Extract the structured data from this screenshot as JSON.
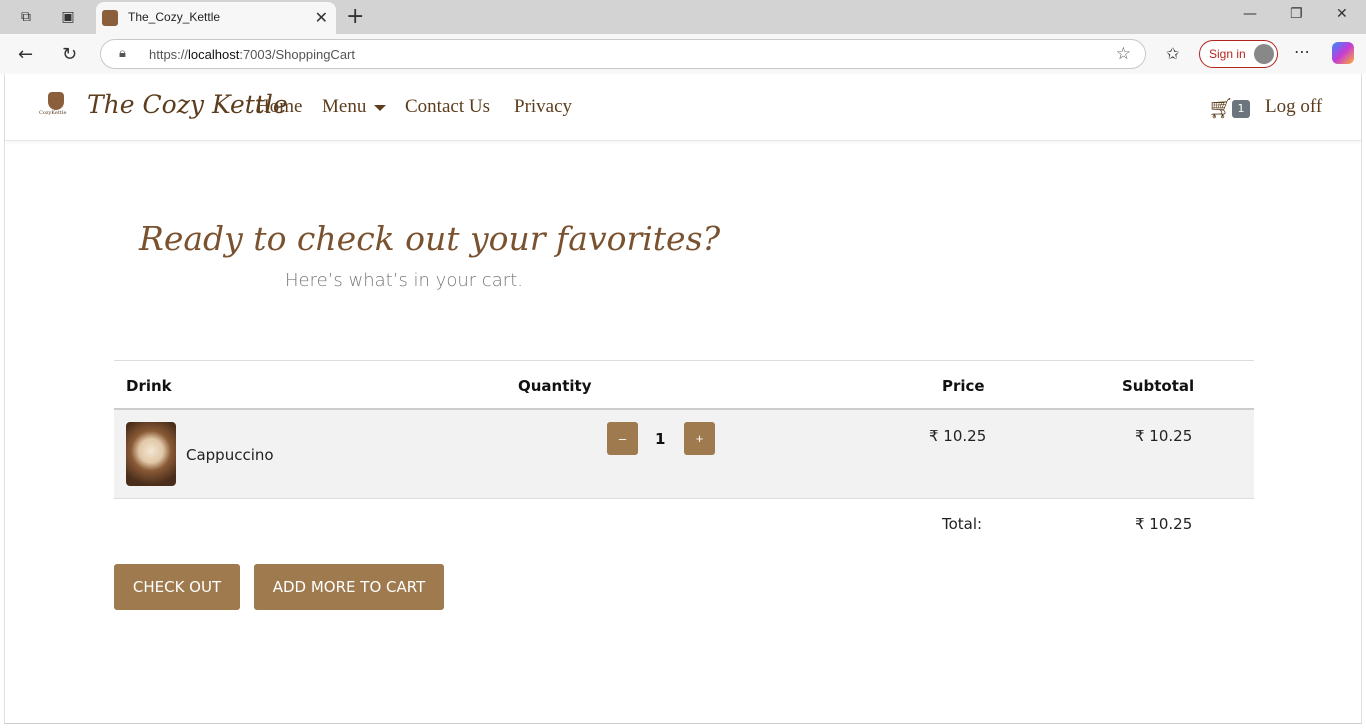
{
  "browser": {
    "tab_title": "The_Cozy_Kettle",
    "url_prefix": "https://",
    "url_host": "localhost",
    "url_path": ":7003/ShoppingCart",
    "signin_label": "Sign in"
  },
  "navbar": {
    "logo_text": "CozyKettle",
    "brand": "The Cozy Kettle",
    "links": [
      "Home",
      "Menu",
      "Contact Us",
      "Privacy"
    ],
    "cart_count": "1",
    "logoff": "Log off"
  },
  "hero": {
    "title": "Ready to check out your favorites?",
    "subtitle": "Here’s what’s in your cart."
  },
  "cart": {
    "headers": {
      "drink": "Drink",
      "quantity": "Quantity",
      "price": "Price",
      "subtotal": "Subtotal"
    },
    "rows": [
      {
        "name": "Cappuccino",
        "quantity": "1",
        "price": "₹ 10.25",
        "subtotal": "₹ 10.25"
      }
    ],
    "minus_label": "–",
    "plus_label": "+",
    "total_label": "Total:",
    "total_value": "₹ 10.25"
  },
  "actions": {
    "checkout": "CHECK OUT",
    "add_more": "ADD MORE TO CART"
  },
  "colors": {
    "accent": "#9e7a4e",
    "brand_text": "#5c3d1e",
    "hero_title": "#7a5230"
  }
}
